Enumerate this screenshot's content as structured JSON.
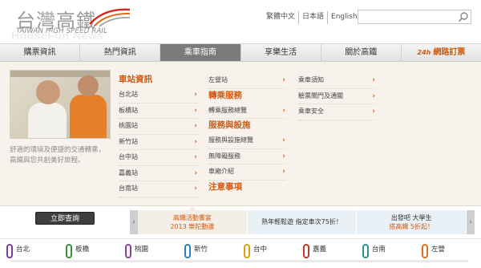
{
  "header": {
    "logo_cn": "台灣高鐵",
    "logo_en": "TAIWAN HIGH SPEED RAIL",
    "watermark": "HouseFun News",
    "lang_links": [
      "繁體中文",
      "日本語",
      "English"
    ],
    "search_placeholder": ""
  },
  "nav": {
    "items": [
      "購票資訊",
      "熱門資訊",
      "乘車指南",
      "享樂生活",
      "關於高鐵"
    ],
    "active_index": 2,
    "book_prefix": "24h",
    "book_label": "網路訂票"
  },
  "panel": {
    "tagline": "舒適的環境及便捷的交通轉乘，高鐵與您共創美好旅程。",
    "col1": {
      "heading": "車站資訊",
      "rows": [
        "台北站",
        "板橋站",
        "桃園站",
        "新竹站",
        "台中站",
        "嘉義站",
        "台南站"
      ]
    },
    "col2": {
      "row_top": "左營站",
      "heading1": "轉乘服務",
      "rows1": [
        "轉乘服務總覽"
      ],
      "heading2": "服務與設施",
      "rows2": [
        "服務與設施總覽",
        "無障礙服務",
        "車廂介紹"
      ],
      "heading3": "注意事項"
    },
    "col3": {
      "rows": [
        "乘車須知",
        "驗票閘門及通關",
        "乘車安全"
      ]
    }
  },
  "query_button": "立即查詢",
  "promos": [
    {
      "line1": "高鐵活動饗宴",
      "line2": "2013 樂陀動盪"
    },
    {
      "line1": "熟年輕鬆遊 指定車次75折！",
      "line2": ""
    },
    {
      "line1": "出發吧 大學生",
      "line2": "搭高鐵 5折起！"
    }
  ],
  "promo_prev": "‹",
  "promo_next": "›",
  "stations": [
    "台北",
    "板橋",
    "桃園",
    "新竹",
    "台中",
    "嘉義",
    "台南",
    "左營"
  ],
  "colors": {
    "accent": "#d45a14",
    "nav_active": "#7a7a7a",
    "station_colors": [
      "#7a3f96",
      "#3a8f3a",
      "#8a3f96",
      "#2d7fb8",
      "#d5a213",
      "#c0392b",
      "#2f8f8f",
      "#e07020"
    ]
  }
}
